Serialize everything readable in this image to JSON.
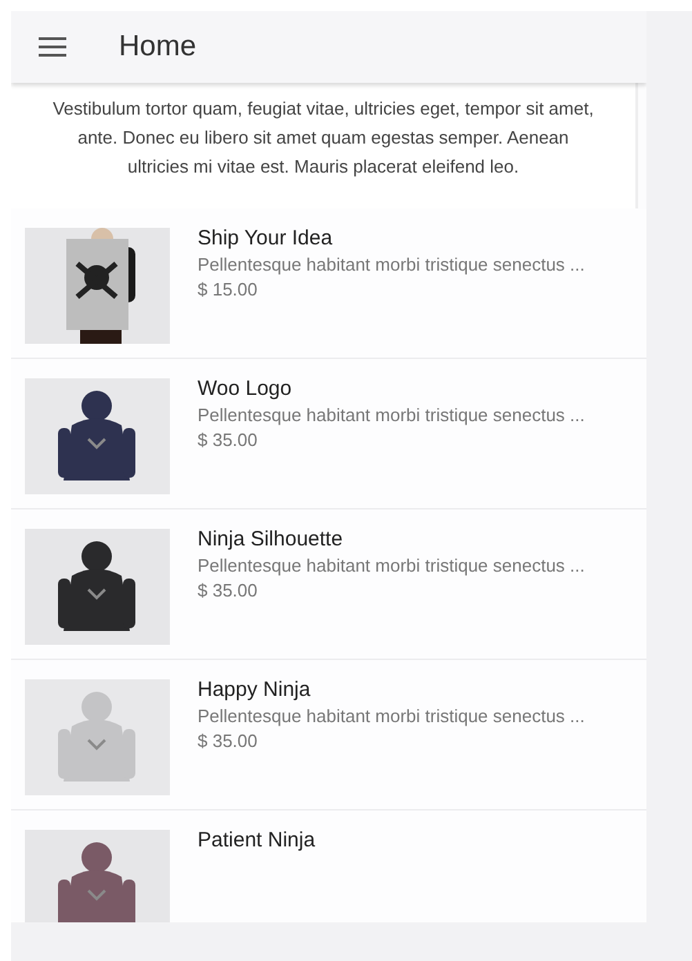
{
  "app_bar": {
    "title": "Home"
  },
  "intro": {
    "text": "Vestibulum tortor quam, feugiat vitae, ultricies eget, tempor sit amet, ante. Donec eu libero sit amet quam egestas semper. Aenean ultricies mi vitae est. Mauris placerat eleifend leo."
  },
  "products": [
    {
      "name": "Ship Your Idea",
      "description": "Pellentesque habitant morbi tristique senectus ...",
      "price": "$ 15.00"
    },
    {
      "name": "Woo Logo",
      "description": "Pellentesque habitant morbi tristique senectus ...",
      "price": "$ 35.00"
    },
    {
      "name": "Ninja Silhouette",
      "description": "Pellentesque habitant morbi tristique senectus ...",
      "price": "$ 35.00"
    },
    {
      "name": "Happy Ninja",
      "description": "Pellentesque habitant morbi tristique senectus ...",
      "price": "$ 35.00"
    },
    {
      "name": "Patient Ninja"
    }
  ]
}
